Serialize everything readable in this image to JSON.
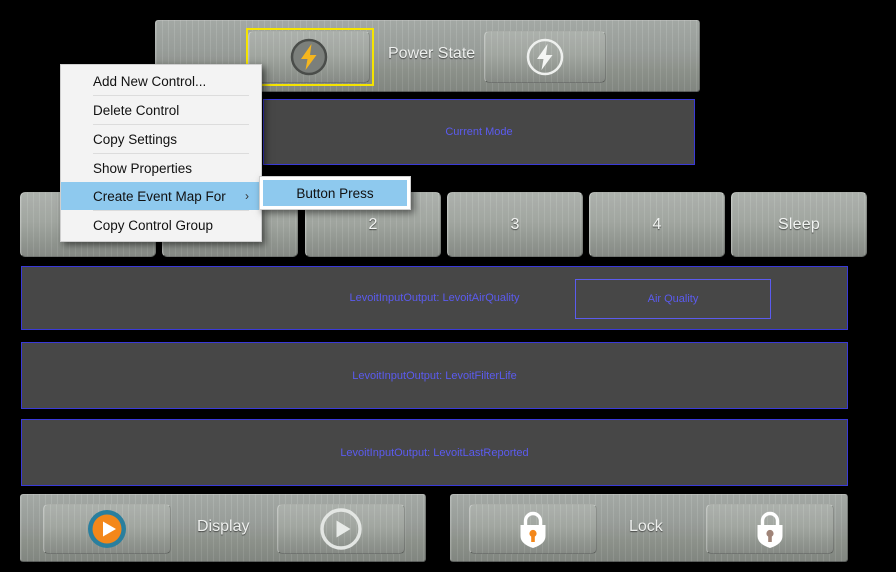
{
  "colors": {
    "background": "#000000",
    "panel_dark": "#474747",
    "panel_border_blue": "#3a3ad8",
    "text_blue": "#5b5bef",
    "selection_yellow": "#f5e400",
    "menu_highlight": "#8ec9ee",
    "icon_amber": "#f5b61e",
    "icon_orange": "#f3871a",
    "icon_teal": "#2a7f9e"
  },
  "power_group": {
    "label": "Power State",
    "on_button": {
      "icon": "power-bolt-on-icon",
      "selected": true
    },
    "off_button": {
      "icon": "power-bolt-off-icon",
      "selected": false
    }
  },
  "current_mode_panel": {
    "text": "Current Mode"
  },
  "mode_buttons": [
    {
      "label": "",
      "occluded": true
    },
    {
      "label": "",
      "occluded": true
    },
    {
      "label": "2",
      "occluded": false
    },
    {
      "label": "3",
      "occluded": false
    },
    {
      "label": "4",
      "occluded": false
    },
    {
      "label": "Sleep",
      "occluded": false
    }
  ],
  "info_panels": [
    {
      "text": "LevoitInputOutput: LevoitAirQuality",
      "nested": {
        "text": "Air Quality"
      }
    },
    {
      "text": "LevoitInputOutput: LevoitFilterLife",
      "nested": null
    },
    {
      "text": "LevoitInputOutput: LevoitLastReported",
      "nested": null
    }
  ],
  "display_group": {
    "label": "Display",
    "on_button": {
      "icon": "play-circle-on-icon"
    },
    "off_button": {
      "icon": "play-circle-off-icon"
    }
  },
  "lock_group": {
    "label": "Lock",
    "on_button": {
      "icon": "lock-on-icon"
    },
    "off_button": {
      "icon": "lock-off-icon"
    }
  },
  "context_menu": {
    "items": [
      {
        "label": "Add New Control...",
        "selected": false,
        "has_submenu": false,
        "separator_after": true
      },
      {
        "label": "Delete Control",
        "selected": false,
        "has_submenu": false,
        "separator_after": true
      },
      {
        "label": "Copy Settings",
        "selected": false,
        "has_submenu": false,
        "separator_after": true
      },
      {
        "label": "Show Properties",
        "selected": false,
        "has_submenu": false,
        "separator_after": false
      },
      {
        "label": "Create Event Map For",
        "selected": true,
        "has_submenu": true,
        "separator_after": true
      },
      {
        "label": "Copy Control Group",
        "selected": false,
        "has_submenu": false,
        "separator_after": false
      }
    ],
    "submenu_arrow": "›",
    "submenu": {
      "items": [
        {
          "label": "Button Press",
          "selected": true
        }
      ]
    }
  }
}
